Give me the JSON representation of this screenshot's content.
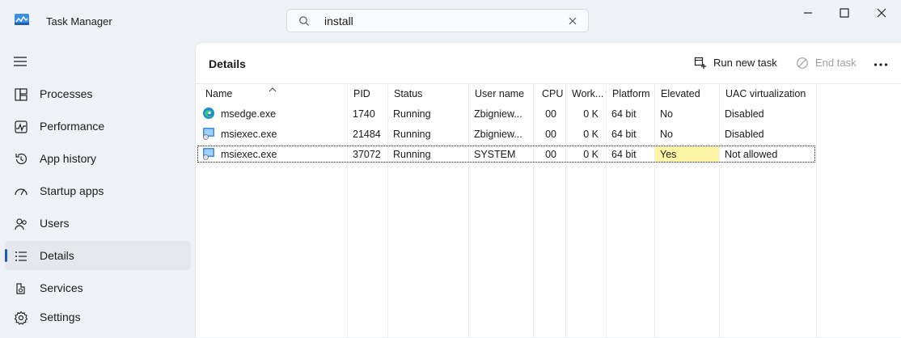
{
  "app": {
    "title": "Task Manager"
  },
  "search": {
    "value": "install"
  },
  "sidebar": {
    "items": [
      {
        "label": "Processes",
        "icon": "processes-icon"
      },
      {
        "label": "Performance",
        "icon": "performance-icon"
      },
      {
        "label": "App history",
        "icon": "app-history-icon"
      },
      {
        "label": "Startup apps",
        "icon": "startup-apps-icon"
      },
      {
        "label": "Users",
        "icon": "users-icon"
      },
      {
        "label": "Details",
        "icon": "details-icon",
        "active": true
      },
      {
        "label": "Services",
        "icon": "services-icon"
      },
      {
        "label": "Settings",
        "icon": "settings-icon"
      }
    ]
  },
  "page": {
    "title": "Details",
    "run_new_task": "Run new task",
    "end_task": "End task"
  },
  "table": {
    "columns": [
      "Name",
      "PID",
      "Status",
      "User name",
      "CPU",
      "Work...",
      "Platform",
      "Elevated",
      "UAC virtualization"
    ],
    "rows": [
      {
        "name": "msedge.exe",
        "pid": "1740",
        "status": "Running",
        "user": "Zbigniew...",
        "cpu": "00",
        "work": "0 K",
        "platform": "64 bit",
        "elevated": "No",
        "uac": "Disabled",
        "icon": "edge-icon"
      },
      {
        "name": "msiexec.exe",
        "pid": "21484",
        "status": "Running",
        "user": "Zbigniew...",
        "cpu": "00",
        "work": "0 K",
        "platform": "64 bit",
        "elevated": "No",
        "uac": "Disabled",
        "icon": "installer-icon"
      },
      {
        "name": "msiexec.exe",
        "pid": "37072",
        "status": "Running",
        "user": "SYSTEM",
        "cpu": "00",
        "work": "0 K",
        "platform": "64 bit",
        "elevated": "Yes",
        "uac": "Not allowed",
        "icon": "installer-icon",
        "selected": true
      }
    ]
  },
  "colors": {
    "accent": "#1a5fb4",
    "elevated_highlight": "#fdf4a6",
    "sidebar_bg": "#eef1f6"
  }
}
